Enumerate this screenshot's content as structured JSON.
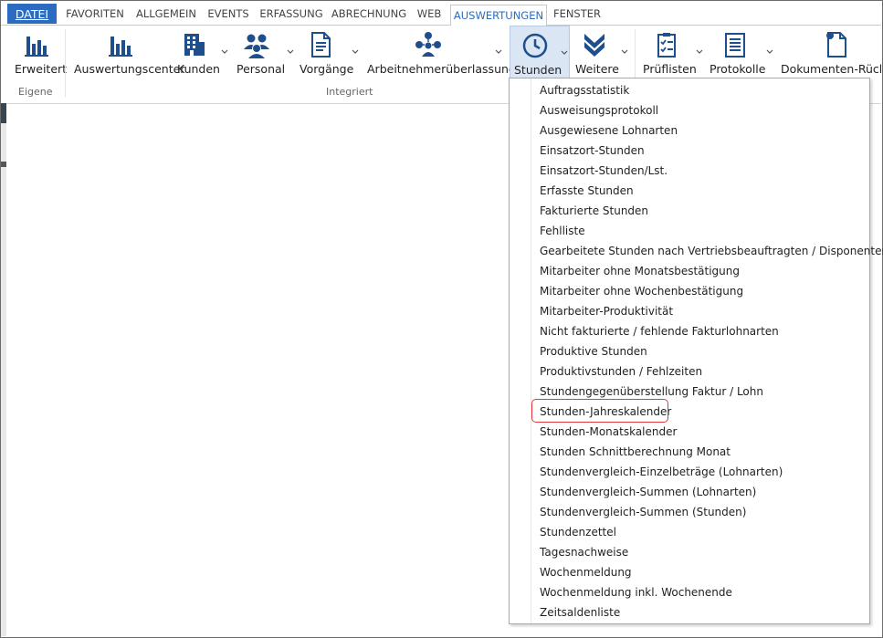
{
  "tabs": [
    {
      "label": "DATEI"
    },
    {
      "label": "FAVORITEN"
    },
    {
      "label": "ALLGEMEIN"
    },
    {
      "label": "EVENTS"
    },
    {
      "label": "ERFASSUNG"
    },
    {
      "label": "ABRECHNUNG"
    },
    {
      "label": "WEB"
    },
    {
      "label": "AUSWERTUNGEN"
    },
    {
      "label": "FENSTER"
    }
  ],
  "active_tab": "AUSWERTUNGEN",
  "ribbon": {
    "buttons": [
      {
        "label": "Erweitert",
        "icon": "bar-chart-icon"
      },
      {
        "label": "Auswertungscenter",
        "icon": "bar-chart-icon"
      },
      {
        "label": "Kunden",
        "icon": "building-icon"
      },
      {
        "label": "Personal",
        "icon": "people-icon"
      },
      {
        "label": "Vorgänge",
        "icon": "document-icon"
      },
      {
        "label": "Arbeitnehmerüberlassung",
        "icon": "network-people-icon"
      },
      {
        "label": "Stunden",
        "icon": "clock-icon"
      },
      {
        "label": "Weitere",
        "icon": "double-chevron-down-icon"
      },
      {
        "label": "Prüflisten",
        "icon": "checklist-icon"
      },
      {
        "label": "Protokolle",
        "icon": "log-icon"
      },
      {
        "label": "Dokumenten-Rücklauf",
        "icon": "document-return-icon"
      }
    ],
    "groups": [
      {
        "label": "Eigene"
      },
      {
        "label": "Integriert"
      }
    ]
  },
  "menu": {
    "items": [
      "Auftragsstatistik",
      "Ausweisungsprotokoll",
      "Ausgewiesene Lohnarten",
      "Einsatzort-Stunden",
      "Einsatzort-Stunden/Lst.",
      "Erfasste Stunden",
      "Fakturierte Stunden",
      "Fehlliste",
      "Gearbeitete Stunden nach Vertriebsbeauftragten / Disponenten",
      "Mitarbeiter ohne Monatsbestätigung",
      "Mitarbeiter ohne Wochenbestätigung",
      "Mitarbeiter-Produktivität",
      "Nicht fakturierte / fehlende Fakturlohnarten",
      "Produktive Stunden",
      "Produktivstunden / Fehlzeiten",
      "Stundengegenüberstellung Faktur / Lohn",
      "Stunden-Jahreskalender",
      "Stunden-Monatskalender",
      "Stunden Schnittberechnung Monat",
      "Stundenvergleich-Einzelbeträge (Lohnarten)",
      "Stundenvergleich-Summen (Lohnarten)",
      "Stundenvergleich-Summen (Stunden)",
      "Stundenzettel",
      "Tagesnachweise",
      "Wochenmeldung",
      "Wochenmeldung inkl. Wochenende",
      "Zeitsaldenliste"
    ],
    "highlighted_item": "Stunden-Jahreskalender"
  },
  "colors": {
    "accent": "#2b6cc0",
    "icon": "#1f4e8c",
    "highlight": "#e0393e"
  }
}
